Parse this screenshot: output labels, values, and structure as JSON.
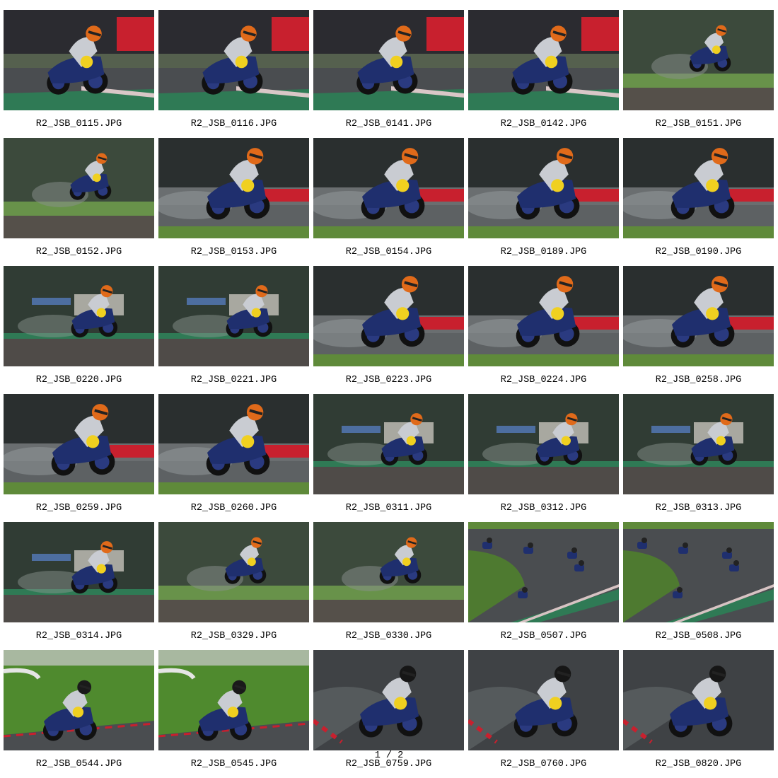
{
  "gallery": {
    "items": [
      {
        "filename": "R2_JSB_0115.JPG",
        "scene": "banner"
      },
      {
        "filename": "R2_JSB_0116.JPG",
        "scene": "banner"
      },
      {
        "filename": "R2_JSB_0141.JPG",
        "scene": "banner"
      },
      {
        "filename": "R2_JSB_0142.JPG",
        "scene": "banner"
      },
      {
        "filename": "R2_JSB_0151.JPG",
        "scene": "far"
      },
      {
        "filename": "R2_JSB_0152.JPG",
        "scene": "far"
      },
      {
        "filename": "R2_JSB_0153.JPG",
        "scene": "wet"
      },
      {
        "filename": "R2_JSB_0154.JPG",
        "scene": "wet"
      },
      {
        "filename": "R2_JSB_0189.JPG",
        "scene": "wet"
      },
      {
        "filename": "R2_JSB_0190.JPG",
        "scene": "wet"
      },
      {
        "filename": "R2_JSB_0220.JPG",
        "scene": "tent"
      },
      {
        "filename": "R2_JSB_0221.JPG",
        "scene": "tent"
      },
      {
        "filename": "R2_JSB_0223.JPG",
        "scene": "wet"
      },
      {
        "filename": "R2_JSB_0224.JPG",
        "scene": "wet"
      },
      {
        "filename": "R2_JSB_0258.JPG",
        "scene": "wet"
      },
      {
        "filename": "R2_JSB_0259.JPG",
        "scene": "wet"
      },
      {
        "filename": "R2_JSB_0260.JPG",
        "scene": "wet"
      },
      {
        "filename": "R2_JSB_0311.JPG",
        "scene": "tent"
      },
      {
        "filename": "R2_JSB_0312.JPG",
        "scene": "tent"
      },
      {
        "filename": "R2_JSB_0313.JPG",
        "scene": "tent"
      },
      {
        "filename": "R2_JSB_0314.JPG",
        "scene": "tent"
      },
      {
        "filename": "R2_JSB_0329.JPG",
        "scene": "far"
      },
      {
        "filename": "R2_JSB_0330.JPG",
        "scene": "far"
      },
      {
        "filename": "R2_JSB_0507.JPG",
        "scene": "track"
      },
      {
        "filename": "R2_JSB_0508.JPG",
        "scene": "track"
      },
      {
        "filename": "R2_JSB_0544.JPG",
        "scene": "dry"
      },
      {
        "filename": "R2_JSB_0545.JPG",
        "scene": "dry"
      },
      {
        "filename": "R2_JSB_0759.JPG",
        "scene": "dark"
      },
      {
        "filename": "R2_JSB_0760.JPG",
        "scene": "dark"
      },
      {
        "filename": "R2_JSB_0820.JPG",
        "scene": "dark"
      }
    ]
  },
  "pagination": {
    "text": "1 / 2"
  },
  "colors": {
    "banner_text": "#ffffff",
    "banner_red": "#c8202e",
    "grass": "#5f8a3a",
    "asphalt": "#4a4d50",
    "bike_blue": "#1f2f6e",
    "helmet_orange": "#e06a1a",
    "number_plate": "#f0d020"
  }
}
